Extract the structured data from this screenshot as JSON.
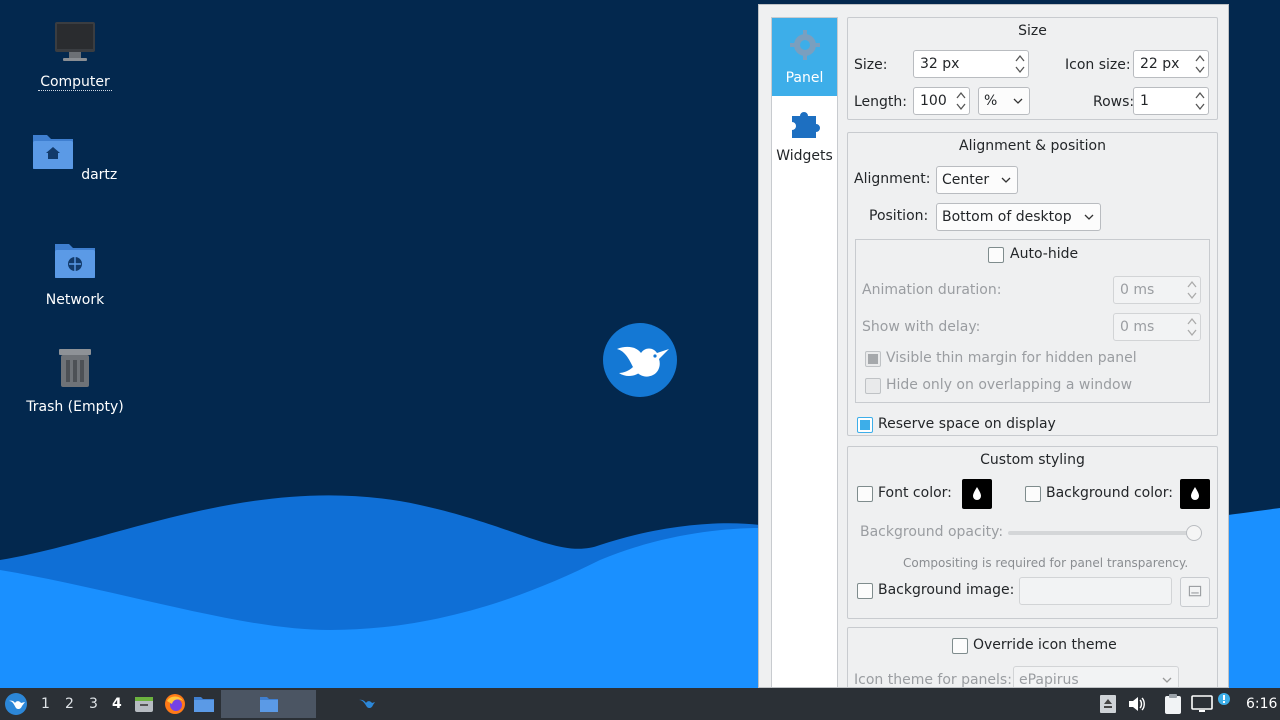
{
  "desktop": {
    "icons": [
      {
        "label": "Computer",
        "icon": "computer-icon"
      },
      {
        "label": "dartz",
        "icon": "home-folder-icon"
      },
      {
        "label": "Network",
        "icon": "network-folder-icon"
      },
      {
        "label": "Trash (Empty)",
        "icon": "trash-icon"
      }
    ],
    "logo": "hummingbird-logo"
  },
  "panel_config": {
    "sidebar": [
      {
        "label": "Panel",
        "icon": "gear-icon"
      },
      {
        "label": "Widgets",
        "icon": "puzzle-icon"
      }
    ],
    "size_group": {
      "title": "Size",
      "size_label": "Size:",
      "size_value": "32 px",
      "icon_size_label": "Icon size:",
      "icon_size_value": "22 px",
      "length_label": "Length:",
      "length_value": "100",
      "length_unit": "%",
      "rows_label": "Rows:",
      "rows_value": "1"
    },
    "alignment_group": {
      "title": "Alignment & position",
      "alignment_label": "Alignment:",
      "alignment_value": "Center",
      "position_label": "Position:",
      "position_value": "Bottom of desktop",
      "autohide_label": "Auto-hide",
      "animation_label": "Animation duration:",
      "animation_value": "0 ms",
      "delay_label": "Show with delay:",
      "delay_value": "0 ms",
      "thin_margin_label": "Visible thin margin for hidden panel",
      "hide_overlap_label": "Hide only on overlapping a window",
      "reserve_label": "Reserve space on display"
    },
    "styling_group": {
      "title": "Custom styling",
      "font_color_label": "Font color:",
      "bg_color_label": "Background color:",
      "opacity_label": "Background opacity:",
      "opacity_level": 1.0,
      "compositing_note": "Compositing is required for panel transparency.",
      "bg_image_label": "Background image:"
    },
    "icon_theme_group": {
      "override_label": "Override icon theme",
      "theme_label": "Icon theme for panels:",
      "theme_value": "ePapirus"
    }
  },
  "taskbar": {
    "workspaces": [
      "1",
      "2",
      "3",
      "4"
    ],
    "active_workspace": "4",
    "clock": "6:16"
  },
  "colors": {
    "accent": "#3daee9",
    "desktop_bg": "#03284e",
    "wave": "#1e90ff",
    "taskbar": "#2b3036"
  }
}
